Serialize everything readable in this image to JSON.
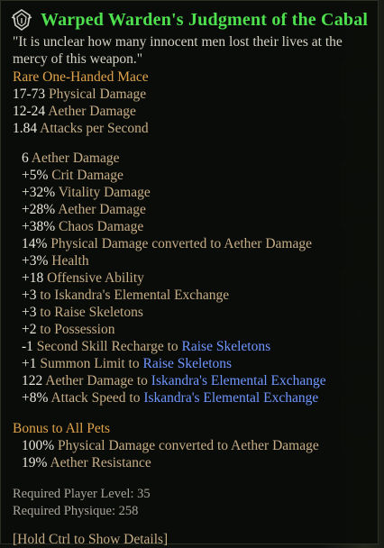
{
  "item": {
    "icon": "set-item-emblem-icon",
    "name": "Warped Warden's Judgment of the Cabal",
    "flavor": "\"It is unclear how many innocent men lost their lives at the mercy of this weapon.\"",
    "rarity_type": "Rare One-Handed Mace",
    "base_stats": [
      {
        "value": "17-73",
        "label": "Physical Damage"
      },
      {
        "value": "12-24",
        "label": "Aether Damage"
      },
      {
        "value": "1.84",
        "label": "Attacks per Second"
      }
    ],
    "modifiers": [
      {
        "value": "6",
        "label": "Aether Damage"
      },
      {
        "value": "+5%",
        "label": "Crit Damage"
      },
      {
        "value": "+32%",
        "label": "Vitality Damage"
      },
      {
        "value": "+28%",
        "label": "Aether Damage"
      },
      {
        "value": "+38%",
        "label": "Chaos Damage"
      },
      {
        "value": "14%",
        "label": "Physical Damage converted to Aether Damage"
      },
      {
        "value": "+3%",
        "label": "Health"
      },
      {
        "value": "+18",
        "label": "Offensive Ability"
      },
      {
        "value": "+3",
        "label": "to Iskandra's Elemental Exchange"
      },
      {
        "value": "+3",
        "label": "to Raise Skeletons"
      },
      {
        "value": "+2",
        "label": "to Possession"
      },
      {
        "value": "-1",
        "label": "Second Skill Recharge to",
        "skill": "Raise Skeletons"
      },
      {
        "value": "+1",
        "label": "Summon Limit to",
        "skill": "Raise Skeletons"
      },
      {
        "value": "122",
        "label": "Aether Damage to",
        "skill": "Iskandra's Elemental Exchange"
      },
      {
        "value": "+8%",
        "label": "Attack Speed to",
        "skill": "Iskandra's Elemental Exchange"
      }
    ],
    "pet_bonus": {
      "heading": "Bonus to All Pets",
      "stats": [
        {
          "value": "100%",
          "label": "Physical Damage converted to Aether Damage"
        },
        {
          "value": "19%",
          "label": "Aether Resistance"
        }
      ]
    },
    "requirements": [
      {
        "label": "Required Player Level:",
        "value": "35"
      },
      {
        "label": "Required Physique:",
        "value": "258"
      }
    ],
    "hint": "[Hold Ctrl to Show Details]"
  },
  "colors": {
    "title": "#4ee04e",
    "stat_value": "#e9e6da",
    "stat_label": "#c6ad86",
    "skill_link": "#6f95ff",
    "rarity": "#e0a24a"
  }
}
